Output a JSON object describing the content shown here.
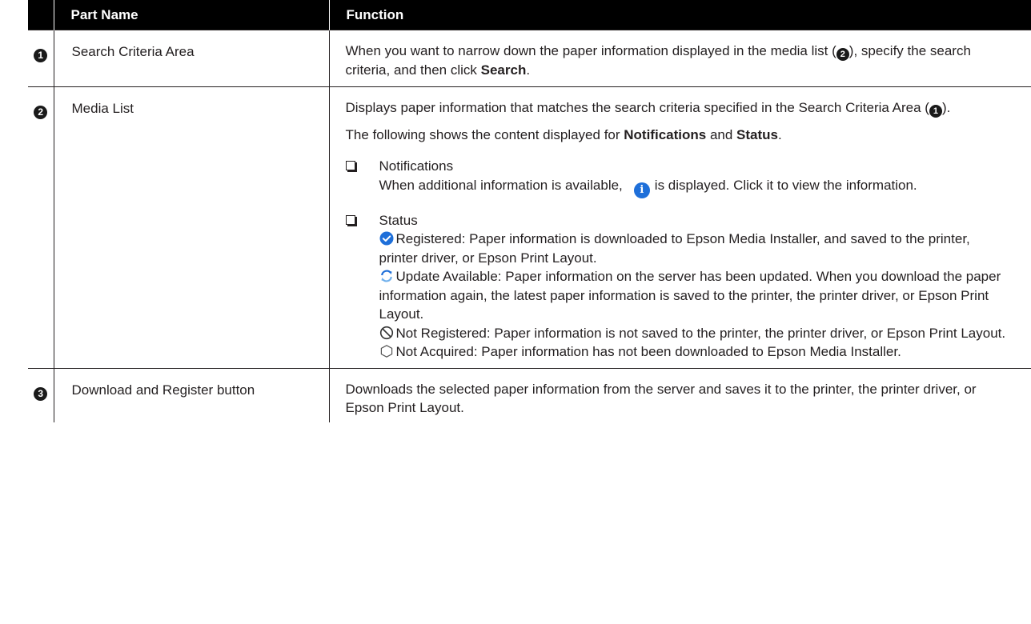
{
  "header": {
    "col_num": "",
    "col_part": "Part Name",
    "col_func": "Function"
  },
  "rows": [
    {
      "num": "1",
      "part": "Search Criteria Area",
      "func": {
        "pre": "When you want to narrow down the paper information displayed in the media list (",
        "ref": "2",
        "mid": "), specify the search criteria, and then click ",
        "bold": "Search",
        "post": "."
      }
    },
    {
      "num": "2",
      "part": "Media List",
      "func": {
        "p1_pre": "Displays paper information that matches the search criteria specified in the Search Criteria Area (",
        "p1_ref": "1",
        "p1_post": ").",
        "p2_pre": "The following shows the content displayed for ",
        "p2_b1": "Notifications",
        "p2_and": " and ",
        "p2_b2": "Status",
        "p2_post": ".",
        "notif_title": "Notifications",
        "notif_pre": "When additional information is available,",
        "notif_post": "is displayed. Click it to view the information.",
        "status_title": "Status",
        "status_items": [
          {
            "icon": "registered-check-icon",
            "text": "Registered: Paper information is downloaded to Epson Media Installer, and saved to the printer, printer driver, or Epson Print Layout."
          },
          {
            "icon": "update-available-icon",
            "text": "Update Available: Paper information on the server has been updated. When you download the paper information again, the latest paper information is saved to the printer, the printer driver, or Epson Print Layout."
          },
          {
            "icon": "not-registered-icon",
            "text": "Not Registered: Paper information is not saved to the printer, the printer driver, or Epson Print Layout."
          },
          {
            "icon": "not-acquired-icon",
            "text": "Not Acquired: Paper information has not been downloaded to Epson Media Installer."
          }
        ]
      }
    },
    {
      "num": "3",
      "part": "Download and Register button",
      "func": {
        "text": "Downloads the selected paper information from the server and saves it to the printer, the printer driver, or Epson Print Layout."
      }
    }
  ],
  "colors": {
    "header_bg": "#000000",
    "info_blue": "#1e6fd9",
    "check_blue": "#1e6fd9"
  }
}
